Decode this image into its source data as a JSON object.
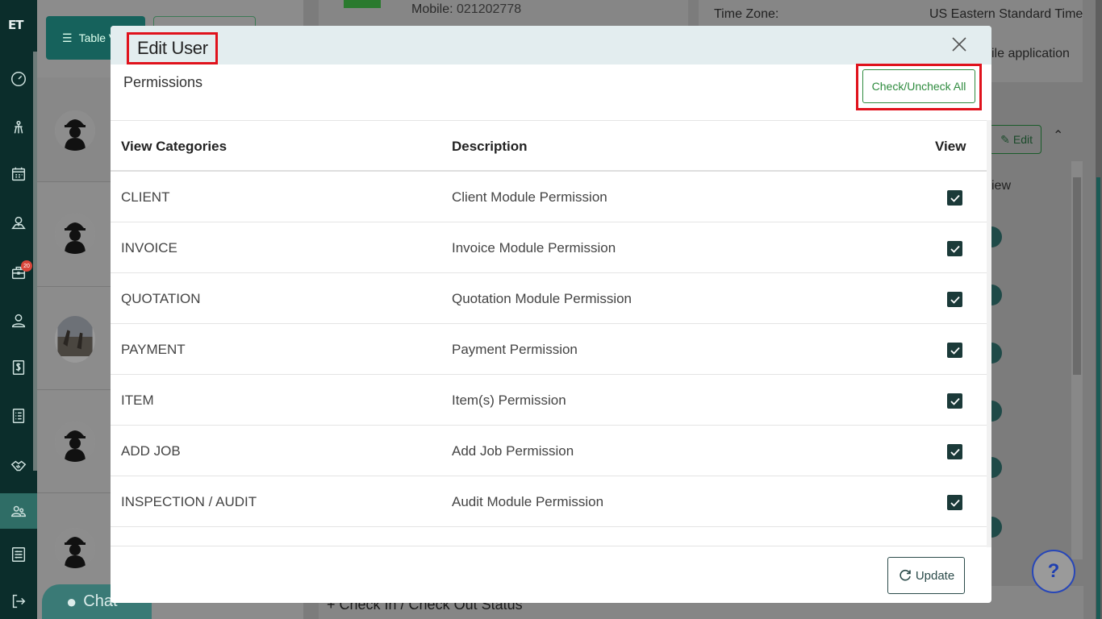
{
  "sidebar": {
    "logo": "ET",
    "badge_count": "20",
    "icons": [
      "dashboard-icon",
      "route-icon",
      "calendar-icon",
      "map-icon",
      "briefcase-icon",
      "user-icon",
      "dollar-icon",
      "list-icon",
      "handshake-icon",
      "users-icon",
      "settings-icon",
      "logout-icon"
    ]
  },
  "background": {
    "table_view_label": "Table V",
    "mobile_label": "Mobile:",
    "mobile_value": "021202778",
    "timezone_label": "Time Zone:",
    "timezone_value": "US Eastern Standard Time",
    "app_text": "ile application",
    "edit_label": "Edit",
    "view_label": "iew",
    "checkin_label": "Check In / Check Out Status",
    "chat_label": "Chat",
    "help_label": "?"
  },
  "modal": {
    "title": "Edit User",
    "permissions_title": "Permissions",
    "check_all_label": "Check/Uncheck All",
    "columns": {
      "category": "View Categories",
      "description": "Description",
      "view": "View"
    },
    "rows": [
      {
        "category": "CLIENT",
        "description": "Client Module Permission",
        "checked": true
      },
      {
        "category": "INVOICE",
        "description": "Invoice Module Permission",
        "checked": true
      },
      {
        "category": "QUOTATION",
        "description": "Quotation Module Permission",
        "checked": true
      },
      {
        "category": "PAYMENT",
        "description": "Payment Permission",
        "checked": true
      },
      {
        "category": "ITEM",
        "description": "Item(s) Permission",
        "checked": true
      },
      {
        "category": "ADD JOB",
        "description": "Add Job Permission",
        "checked": true
      },
      {
        "category": "INSPECTION / AUDIT",
        "description": "Audit Module Permission",
        "checked": true
      }
    ],
    "update_label": "Update"
  },
  "colors": {
    "sidebar_bg": "#0b2d2b",
    "accent_green": "#2e8b3e",
    "highlight_red": "#e0121c",
    "checkbox": "#1b3a39"
  }
}
